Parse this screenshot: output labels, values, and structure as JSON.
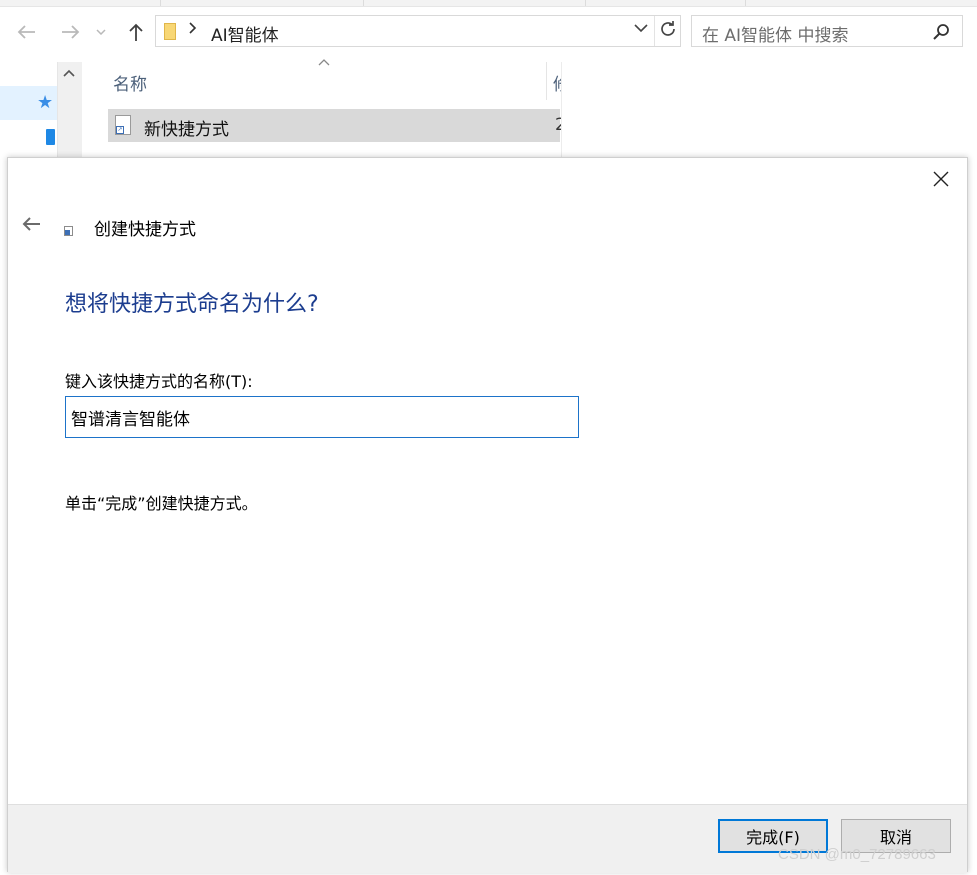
{
  "explorer": {
    "address": {
      "path_label": "AI智能体"
    },
    "search": {
      "placeholder": "在 AI智能体 中搜索"
    },
    "list": {
      "column_name": "名称",
      "column_next_partial": "修",
      "file_name": "新快捷方式",
      "file_date_partial": "2"
    }
  },
  "dialog": {
    "title": "创建快捷方式",
    "heading": "想将快捷方式命名为什么?",
    "label": "键入该快捷方式的名称(T):",
    "input_value": "智谱清言智能体",
    "hint": "单击“完成”创建快捷方式。",
    "buttons": {
      "finish": "完成(F)",
      "cancel": "取消"
    }
  },
  "watermark": "CSDN @m0_72789663",
  "colors": {
    "heading": "#1c3d8f",
    "focus_border": "#0078d7",
    "selection": "#d9d9d9"
  }
}
